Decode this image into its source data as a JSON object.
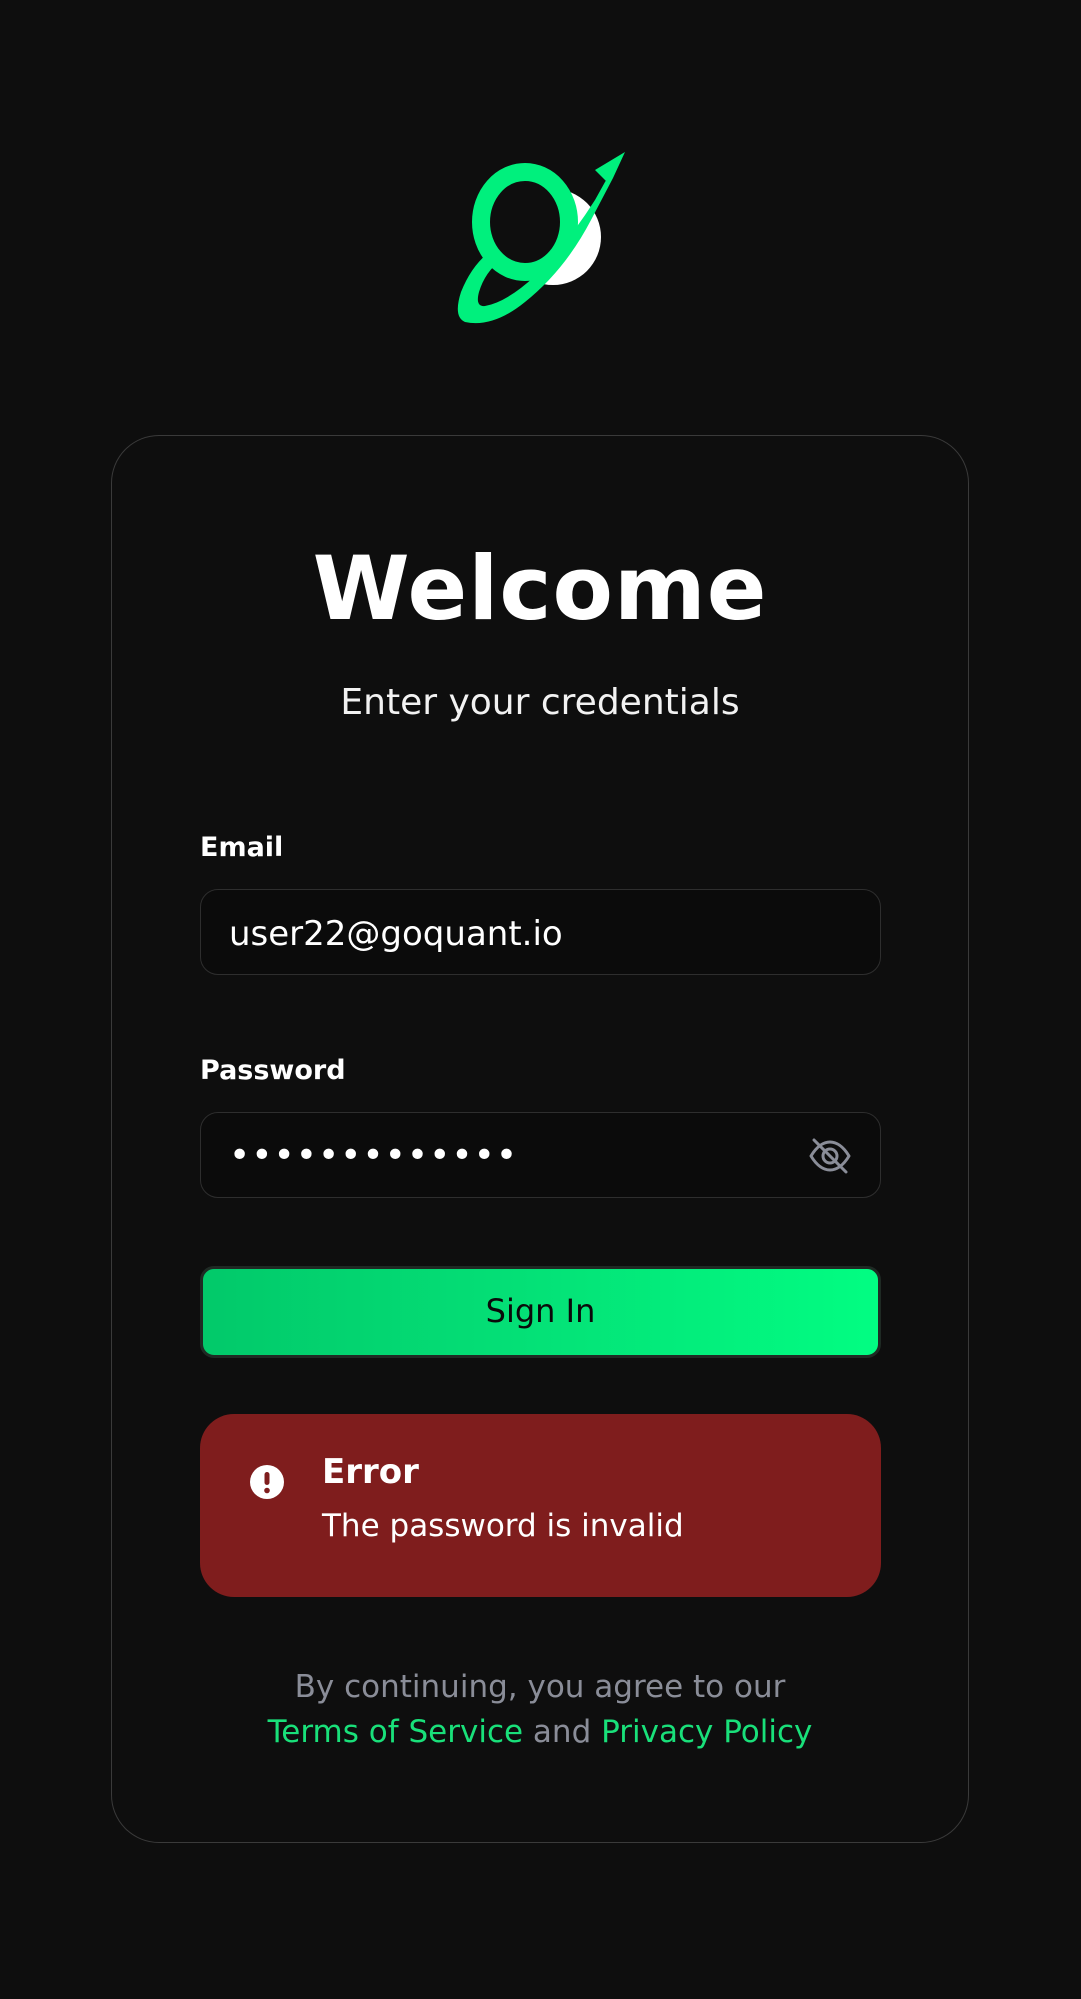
{
  "brand": {
    "logo_icon": "planet-orbit-logo",
    "accent_color": "#00f07d"
  },
  "login": {
    "title": "Welcome",
    "subtitle": "Enter your credentials",
    "email_label": "Email",
    "email_value": "user22@goquant.io",
    "password_label": "Password",
    "password_mask": "•••••••••••••",
    "password_toggle_icon": "eye-off-icon",
    "signin_label": "Sign In"
  },
  "error": {
    "icon": "exclamation-circle-icon",
    "title": "Error",
    "message": "The password is invalid",
    "color": "#7f1d1d"
  },
  "legal": {
    "prefix": "By continuing, you agree to our",
    "terms_label": "Terms of Service",
    "conjunction": "and",
    "privacy_label": "Privacy Policy"
  }
}
